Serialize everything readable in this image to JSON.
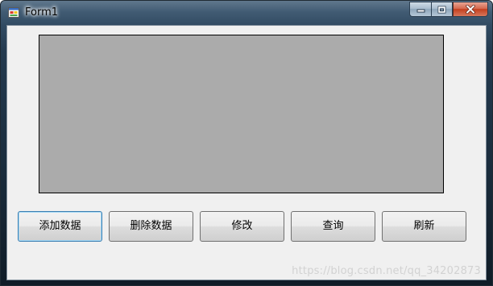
{
  "window": {
    "title": "Form1",
    "icon": "form-app-icon",
    "caption_buttons": {
      "minimize_icon": "minimize-icon",
      "maximize_icon": "maximize-icon",
      "close_icon": "close-icon"
    }
  },
  "panel": {
    "color": "#ababab"
  },
  "buttons": [
    {
      "label": "添加数据"
    },
    {
      "label": "删除数据"
    },
    {
      "label": "修改"
    },
    {
      "label": "查询"
    },
    {
      "label": "刷新"
    }
  ],
  "watermark": "https://blog.csdn.net/qq_34202873"
}
